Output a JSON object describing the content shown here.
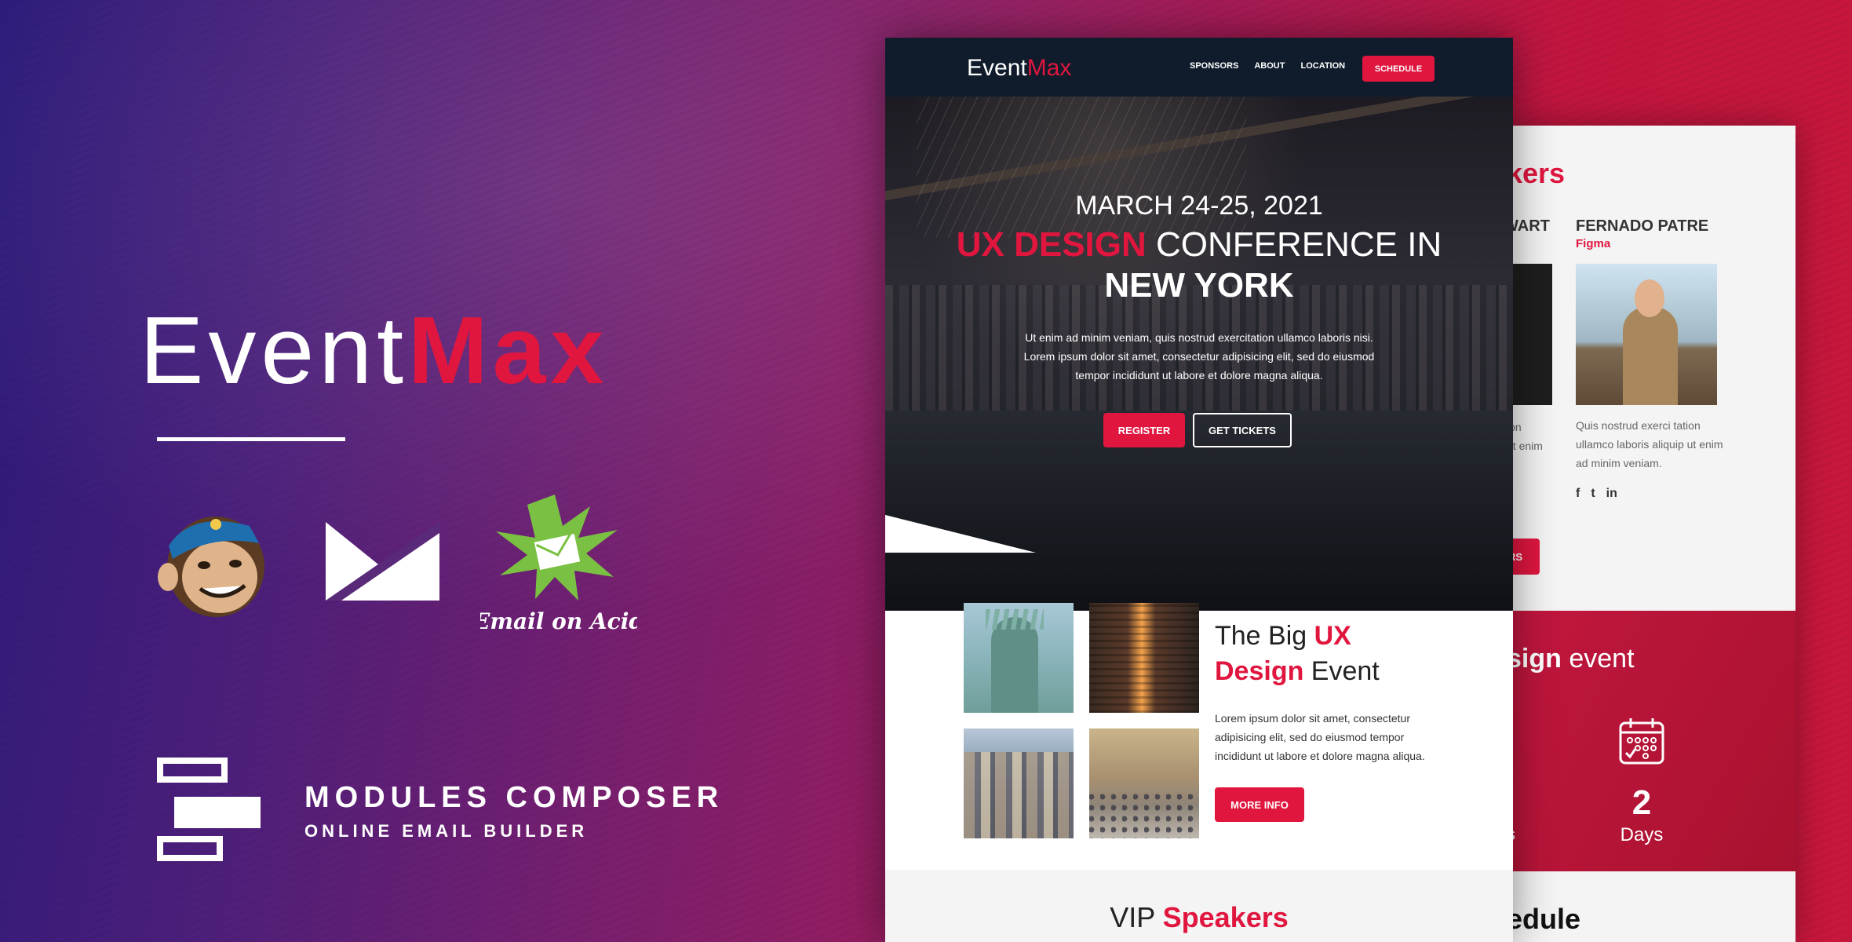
{
  "brand": {
    "name_part1": "Event",
    "name_part2": "Max"
  },
  "partners": {
    "acid_logo_text": "Email on Acid"
  },
  "composer": {
    "title": "MODULES COMPOSER",
    "subtitle": "ONLINE EMAIL BUILDER"
  },
  "email": {
    "nav": {
      "logo_part1": "Event",
      "logo_part2": "Max",
      "links": [
        "SPONSORS",
        "ABOUT",
        "LOCATION"
      ],
      "cta": "SCHEDULE"
    },
    "hero": {
      "date": "MARCH 24-25, 2021",
      "title_highlight": "UX DESIGN",
      "title_rest": " CONFERENCE IN",
      "title_line2": "NEW YORK",
      "text": "Ut enim ad minim veniam, quis nostrud exercitation ullamco laboris nisi. Lorem ipsum dolor sit amet, consectetur adipisicing elit, sed do eiusmod tempor incididunt ut labore et dolore magna aliqua.",
      "register_label": "REGISTER",
      "tickets_label": "GET TICKETS"
    },
    "event": {
      "title_pre": "The Big ",
      "title_hl1": "UX",
      "title_hl2": "Design",
      "title_post": " Event",
      "text": "Lorem ipsum dolor sit amet, consectetur adipisicing elit, sed do eiusmod tempor incididunt ut labore et dolore magna aliqua.",
      "more_label": "MORE INFO"
    },
    "vip": {
      "pre": "VIP ",
      "hl": "Speakers"
    }
  },
  "back_page": {
    "section_fragment": "kers",
    "name_fragment": "WART",
    "bio_fragment_1": "ion",
    "bio_fragment_2": "ut enim",
    "speaker_name": "FERNADO PATRE",
    "speaker_company": "Figma",
    "speaker_bio": "Quis nostrud exerci tation ullamco laboris aliquip ut enim ad minim veniam.",
    "socials": [
      "f",
      "t",
      "in"
    ],
    "button_fragment": "RS",
    "band_title_fragment_bold": "sign",
    "band_title_fragment_rest": " event",
    "days_value": "2",
    "days_label": "Days",
    "left_fragment": "s",
    "schedule_fragment": "edule"
  },
  "colors": {
    "accent": "#e0163f",
    "nav_bg": "#101c2c"
  }
}
